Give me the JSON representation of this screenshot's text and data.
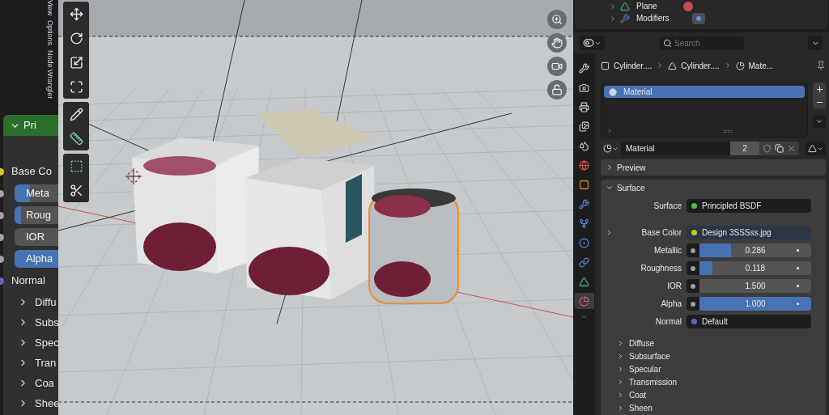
{
  "node_editor": {
    "side_tabs": [
      {
        "label": "View"
      },
      {
        "label": "Options"
      },
      {
        "label": "Node Wrangler"
      }
    ],
    "node": {
      "title": "Pri",
      "expanded": true,
      "inputs": [
        {
          "kind": "socket",
          "label": "Base Co",
          "color": "#d4cc1e"
        },
        {
          "kind": "slider",
          "label": "Meta",
          "level": 0.286,
          "color": "#a1a1a1"
        },
        {
          "kind": "slider",
          "label": "Roug",
          "level": 0.118,
          "color": "#a1a1a1"
        },
        {
          "kind": "number",
          "label": "IOR",
          "color": "#a1a1a1"
        },
        {
          "kind": "slider",
          "label": "Alpha",
          "level": 1,
          "color": "#a1a1a1"
        },
        {
          "kind": "socket",
          "label": "Normal",
          "color": "#6363c7"
        }
      ],
      "panels": [
        {
          "label": "Diffu"
        },
        {
          "label": "Subs"
        },
        {
          "label": "Spec"
        },
        {
          "label": "Tran"
        },
        {
          "label": "Coa"
        },
        {
          "label": "Shee"
        }
      ]
    }
  },
  "viewport": {
    "tools": [
      {
        "kind": "move",
        "selected": false
      },
      {
        "kind": "rotate",
        "selected": false
      },
      {
        "kind": "scale",
        "selected": false
      },
      {
        "kind": "transform",
        "selected": false
      },
      {
        "kind": "annotate",
        "selected": false
      },
      {
        "kind": "measure",
        "selected": false
      },
      {
        "kind": "add-cube",
        "selected": false
      },
      {
        "kind": "knife",
        "selected": false
      }
    ],
    "navigation": [
      {
        "kind": "zoom"
      },
      {
        "kind": "pan"
      },
      {
        "kind": "camera"
      },
      {
        "kind": "lock"
      }
    ]
  },
  "outliner": {
    "items": [
      {
        "label": "Plane",
        "kind": "data"
      },
      {
        "label": "Modifiers",
        "kind": "modifiers"
      }
    ]
  },
  "properties": {
    "search": {
      "placeholder": "Search"
    },
    "tabs": [
      {
        "kind": "tool",
        "selected": false
      },
      {
        "kind": "render",
        "selected": false
      },
      {
        "kind": "output",
        "selected": false
      },
      {
        "kind": "view-layer",
        "selected": false
      },
      {
        "kind": "scene",
        "selected": false
      },
      {
        "kind": "world",
        "selected": false
      },
      {
        "kind": "object",
        "selected": false
      },
      {
        "kind": "modifiers",
        "selected": false
      },
      {
        "kind": "particles",
        "selected": false
      },
      {
        "kind": "physics",
        "selected": false
      },
      {
        "kind": "constraints",
        "selected": false
      },
      {
        "kind": "data",
        "selected": false
      },
      {
        "kind": "material",
        "selected": true
      }
    ],
    "breadcrumb": [
      {
        "kind": "object",
        "label": "Cylinder...."
      },
      {
        "kind": "mesh",
        "label": "Cylinder...."
      },
      {
        "kind": "material",
        "label": "Mate..."
      }
    ],
    "slots": [
      {
        "label": "Material",
        "selected": true
      }
    ],
    "material": {
      "name": "Material",
      "users": "2"
    },
    "panels": [
      {
        "label": "Preview",
        "expanded": false
      },
      {
        "label": "Surface",
        "expanded": true
      }
    ],
    "fields": [
      {
        "kind": "link",
        "label": "Surface",
        "value": "Principled BSDF",
        "color": "#4cc04c"
      },
      {
        "kind": "texture",
        "label": "Base Color",
        "value": "Design 3SSSss.jpg",
        "color": "#c8c81e"
      },
      {
        "kind": "slider",
        "label": "Metallic",
        "value": "0.286",
        "level": 0.286
      },
      {
        "kind": "slider",
        "label": "Roughness",
        "value": "0.118",
        "level": 0.118
      },
      {
        "kind": "number",
        "label": "IOR",
        "value": "1.500"
      },
      {
        "kind": "slider",
        "label": "Alpha",
        "value": "1.000",
        "level": 1
      },
      {
        "kind": "link",
        "label": "Normal",
        "value": "Default",
        "color": "#6363c7"
      }
    ],
    "subpanels": [
      {
        "label": "Diffuse"
      },
      {
        "label": "Subsurface"
      },
      {
        "label": "Specular"
      },
      {
        "label": "Transmission"
      },
      {
        "label": "Coat"
      },
      {
        "label": "Sheen"
      }
    ]
  }
}
